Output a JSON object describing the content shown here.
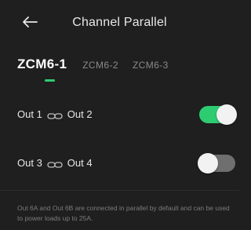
{
  "header": {
    "title": "Channel Parallel",
    "back_icon": "arrow-left-icon"
  },
  "tabs": [
    {
      "label": "ZCM6-1",
      "active": true
    },
    {
      "label": "ZCM6-2",
      "active": false
    },
    {
      "label": "ZCM6-3",
      "active": false
    }
  ],
  "rows": [
    {
      "left": "Out 1",
      "right": "Out 2",
      "icon": "link-icon",
      "enabled": true
    },
    {
      "left": "Out 3",
      "right": "Out 4",
      "icon": "link-icon",
      "enabled": false
    }
  ],
  "note": "Out 6A and Out 6B are connected in parallel by default and can be used to power loads up to 25A.",
  "colors": {
    "background": "#1f1f1f",
    "accent": "#2ecc71",
    "toggle_off": "#6f6f6f"
  }
}
